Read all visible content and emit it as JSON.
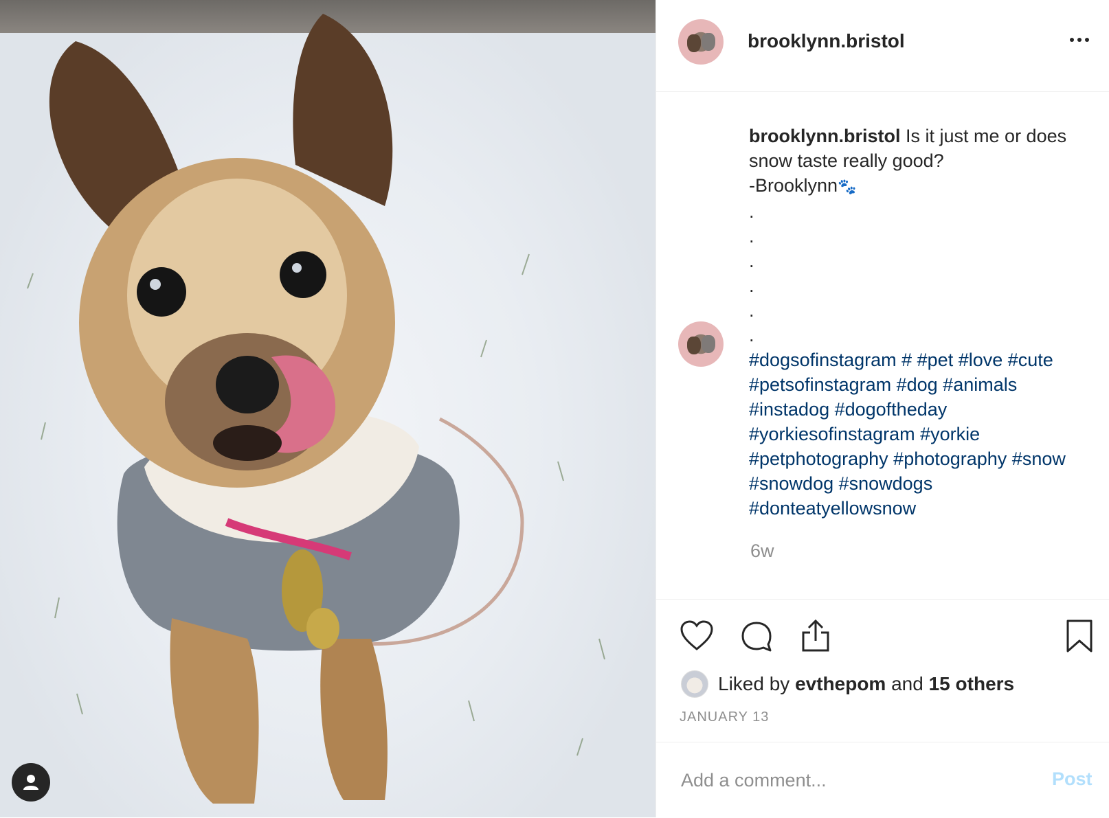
{
  "post": {
    "username": "brooklynn.bristol",
    "caption_text": " Is it just me or does snow taste really good?",
    "signature": "-Brooklynn",
    "paw_icon": "paw-icon",
    "dots": [
      ".",
      ".",
      ".",
      ".",
      ".",
      "."
    ],
    "hashtags": "#dogsofinstagram # #pet #love #cute #petsofinstagram #dog #animals #instadog #dogoftheday #yorkiesofinstagram #yorkie #petphotography #photography #snow #snowdog #snowdogs #donteatyellowsnow",
    "time_ago": "6w"
  },
  "likes": {
    "prefix": "Liked by",
    "user": "evthepom",
    "conjunction": "and",
    "others": "15 others"
  },
  "date": "JANUARY 13",
  "comment": {
    "placeholder": "Add a comment...",
    "post_label": "Post"
  },
  "colors": {
    "hashtag": "#003569",
    "muted": "#8e8e8e",
    "post_disabled": "#b2dffc",
    "text": "#262626"
  }
}
